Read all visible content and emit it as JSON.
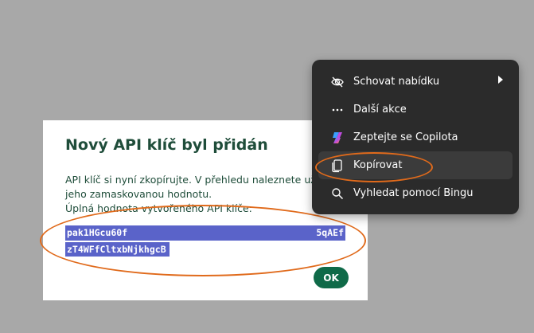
{
  "dialog": {
    "title": "Nový API klíč byl přidán",
    "line1": "API klíč si nyní zkopírujte. V přehledu naleznete už jen",
    "line2": "jeho zamaskovanou hodnotu.",
    "line3": "Úplná hodnota vytvořeného API klíče:",
    "key_part1": "pak1HGcu60f",
    "key_part1_end": "5qAEf",
    "key_part2": "zT4WFfCltxbNjkhgcB",
    "ok_label": "OK"
  },
  "context_menu": {
    "items": [
      {
        "label": "Schovat nabídku",
        "icon": "eye-slash-icon",
        "submenu": true
      },
      {
        "label": "Další akce",
        "icon": "more-dots-icon"
      },
      {
        "label": "Zeptejte se Copilota",
        "icon": "copilot-icon"
      },
      {
        "label": "Kopírovat",
        "icon": "copy-icon",
        "active": true
      },
      {
        "label": "Vyhledat pomocí Bingu",
        "icon": "search-icon"
      }
    ]
  },
  "colors": {
    "overlay": "#a8a8a8",
    "title_green": "#1f4d3a",
    "ok_green": "#0f6a48",
    "selection": "#5a63c9",
    "menu_bg": "#2b2b2b",
    "annotation_orange": "#e06a1b"
  }
}
